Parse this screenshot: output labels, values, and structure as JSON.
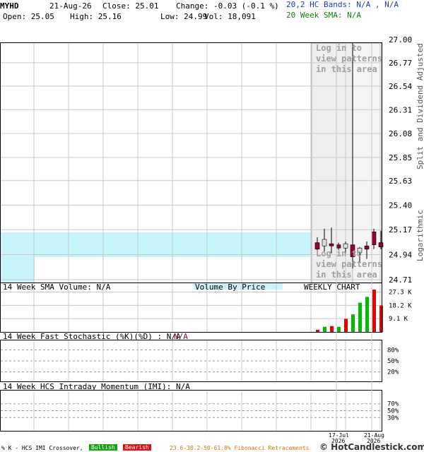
{
  "header": {
    "symbol": "MYHD",
    "date": "21-Aug-26",
    "close": "Close: 25.01",
    "change": "Change: -0.03 (-0.1 %)",
    "open": "Open: 25.05",
    "high": "High: 25.16",
    "low": "Low: 24.99",
    "vol": "Vol: 18,091",
    "hc_bands": "20,2 HC Bands: N/A , N/A",
    "sma": "20 Week SMA: N/A"
  },
  "watermark": {
    "line1": "Log in to",
    "line2": "view patterns",
    "line3": "in this area"
  },
  "side_labels": {
    "top": "Split and Dividend Adjusted",
    "bottom": "Logarithmic"
  },
  "panels": {
    "volume_title": "14 Week SMA Volume: N/A",
    "volume_by_price": "Volume By Price",
    "weekly_chart": "WEEKLY CHART",
    "stochastic_title": "14 Week Fast Stochastic (%K)(%D) : N/A",
    "stochastic_na": "N/A",
    "imi_title": "14 Week HCS Intraday Momentum (IMI): N/A"
  },
  "footer": {
    "crossover": "% K - HCS IMI Crossover,",
    "bullish": "Bullish",
    "bearish": "Bearish",
    "fibonacci": "23.6-38.2-50-61.8% Fibonacci Retracements",
    "brand": "© HotCandlestick.com"
  },
  "colors": {
    "bull": "#dddddd",
    "bear": "#990033",
    "vol_up": "#00bb00",
    "vol_down": "#ee0000",
    "band": "#c8f4fb"
  },
  "chart_data": [
    {
      "type": "candlestick",
      "title": "MYHD",
      "scale": "logarithmic",
      "ylim": [
        24.71,
        27.0
      ],
      "y_ticks": [
        "27.00",
        "26.77",
        "26.54",
        "26.31",
        "26.08",
        "25.85",
        "25.63",
        "25.40",
        "25.17",
        "24.94",
        "24.71"
      ],
      "x_ticks": [
        {
          "label": "17-Jul",
          "year": "2026",
          "index": 3
        },
        {
          "label": "21-Aug",
          "year": "2026",
          "index": 8
        }
      ],
      "candles": [
        {
          "o": 25.05,
          "h": 25.1,
          "l": 24.97,
          "c": 24.99
        },
        {
          "o": 25.02,
          "h": 25.18,
          "l": 24.97,
          "c": 25.08
        },
        {
          "o": 25.04,
          "h": 25.19,
          "l": 24.95,
          "c": 25.02
        },
        {
          "o": 25.03,
          "h": 25.05,
          "l": 24.98,
          "c": 25.0
        },
        {
          "o": 25.0,
          "h": 25.06,
          "l": 24.95,
          "c": 25.04
        },
        {
          "o": 25.03,
          "h": 25.06,
          "l": 24.86,
          "c": 24.92
        },
        {
          "o": 24.96,
          "h": 25.01,
          "l": 24.87,
          "c": 25.0
        },
        {
          "o": 25.02,
          "h": 25.06,
          "l": 24.9,
          "c": 24.99
        },
        {
          "o": 25.15,
          "h": 25.18,
          "l": 24.99,
          "c": 25.03
        },
        {
          "o": 25.05,
          "h": 25.16,
          "l": 24.99,
          "c": 25.01
        }
      ],
      "band": [
        24.96,
        25.17
      ],
      "volume_by_price_bar": {
        "low": 24.71,
        "high": 24.96,
        "relative_width": 0.09
      },
      "pattern_marker_index": 6
    },
    {
      "type": "bar",
      "title": "14 Week SMA Volume: N/A",
      "y_ticks": [
        "27.3 K",
        "18.2 K",
        "9.1 K"
      ],
      "ylim": [
        0,
        29000
      ],
      "values": [
        1500,
        3500,
        4000,
        3500,
        9000,
        12000,
        20000,
        24000,
        29000,
        18091
      ],
      "up": [
        false,
        true,
        false,
        true,
        false,
        true,
        true,
        true,
        false,
        false
      ]
    },
    {
      "type": "line",
      "title": "14 Week Fast Stochastic (%K)(%D) : N/A",
      "y_ticks": [
        "80%",
        "50%",
        "20%"
      ],
      "ylim": [
        0,
        100
      ]
    },
    {
      "type": "line",
      "title": "14 Week HCS Intraday Momentum (IMI): N/A",
      "y_ticks": [
        "70%",
        "50%",
        "30%"
      ],
      "ylim": [
        0,
        100
      ]
    }
  ]
}
